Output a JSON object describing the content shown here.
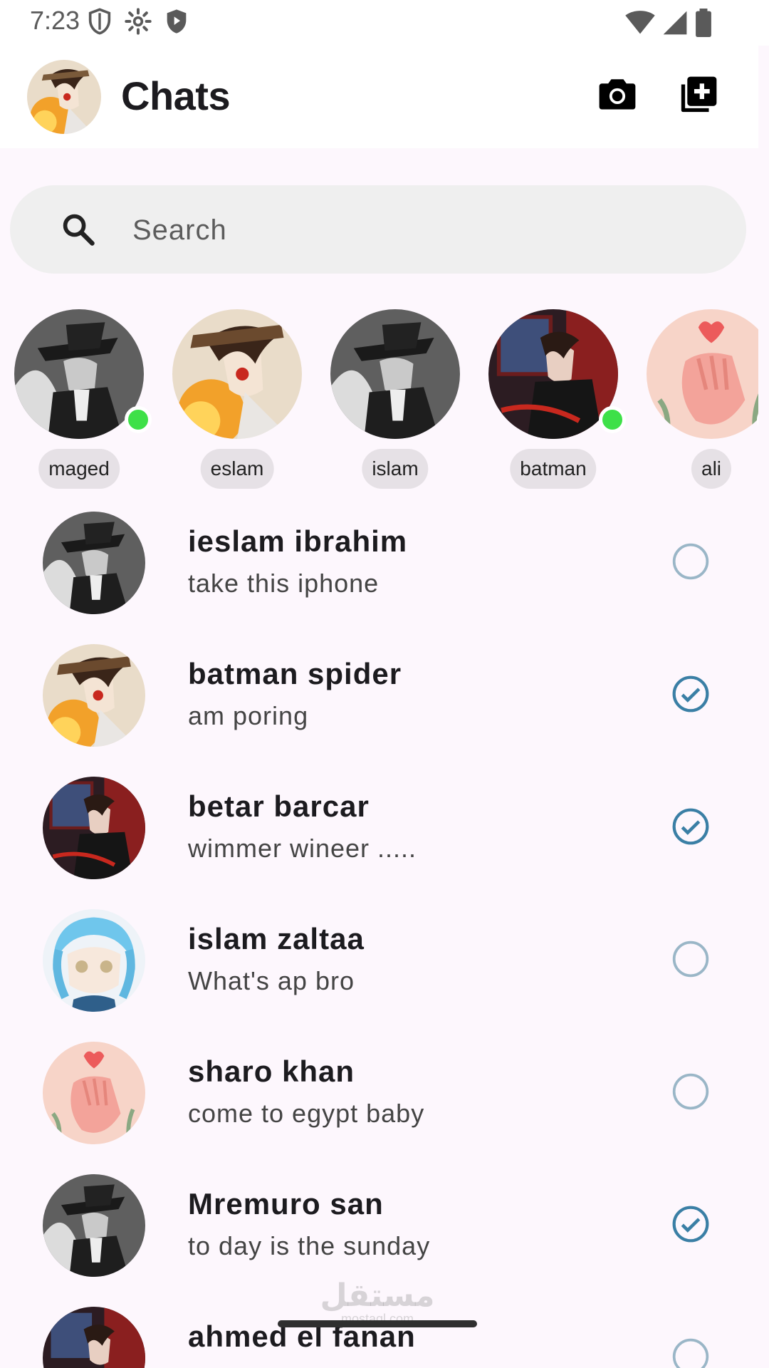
{
  "status_bar": {
    "time": "7:23",
    "icons_left": [
      "shield-icon",
      "gear-icon",
      "play-shield-icon"
    ],
    "icons_right": [
      "wifi-icon",
      "signal-icon",
      "battery-icon"
    ]
  },
  "app_bar": {
    "title": "Chats",
    "actions": [
      "camera-icon",
      "add-box-icon"
    ]
  },
  "search": {
    "placeholder": "Search"
  },
  "stories": [
    {
      "name": "maged",
      "online": true
    },
    {
      "name": "eslam",
      "online": false
    },
    {
      "name": "islam",
      "online": false
    },
    {
      "name": "batman",
      "online": true
    },
    {
      "name": "ali",
      "online": true
    }
  ],
  "chats": [
    {
      "name": "ieslam ibrahim",
      "message": "take this iphone",
      "read": false
    },
    {
      "name": "batman spider",
      "message": "am poring",
      "read": true
    },
    {
      "name": "betar barcar",
      "message": "wimmer wineer .....",
      "read": true
    },
    {
      "name": "islam zaltaa",
      "message": "What's ap bro",
      "read": false
    },
    {
      "name": "sharo khan",
      "message": "come to egypt baby",
      "read": false
    },
    {
      "name": "Mremuro san",
      "message": "to day is the sunday",
      "read": true
    },
    {
      "name": "ahmed el fanan",
      "message": "",
      "read": false
    }
  ],
  "watermark": {
    "text": "مستقل",
    "sub": "mostaql.com"
  },
  "colors": {
    "background": "#fdf7fd",
    "search_bg": "#efefef",
    "online": "#3ee048",
    "check": "#3a7fa5",
    "chip_bg": "#e6e1e6"
  }
}
